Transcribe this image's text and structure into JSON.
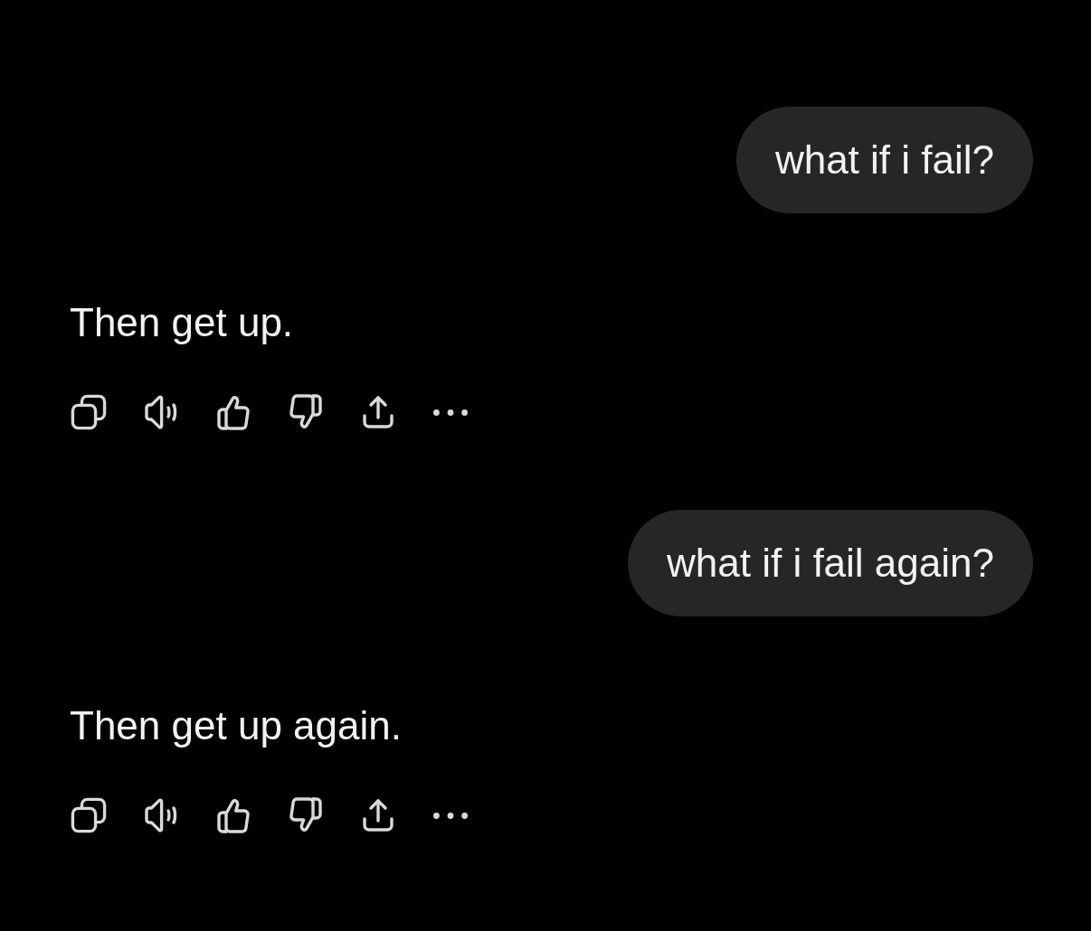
{
  "messages": [
    {
      "kind": "user",
      "text": "what if i fail?"
    },
    {
      "kind": "assistant",
      "text": "Then get up."
    },
    {
      "kind": "user",
      "text": "what if i fail again?"
    },
    {
      "kind": "assistant",
      "text": "Then get up again."
    }
  ]
}
